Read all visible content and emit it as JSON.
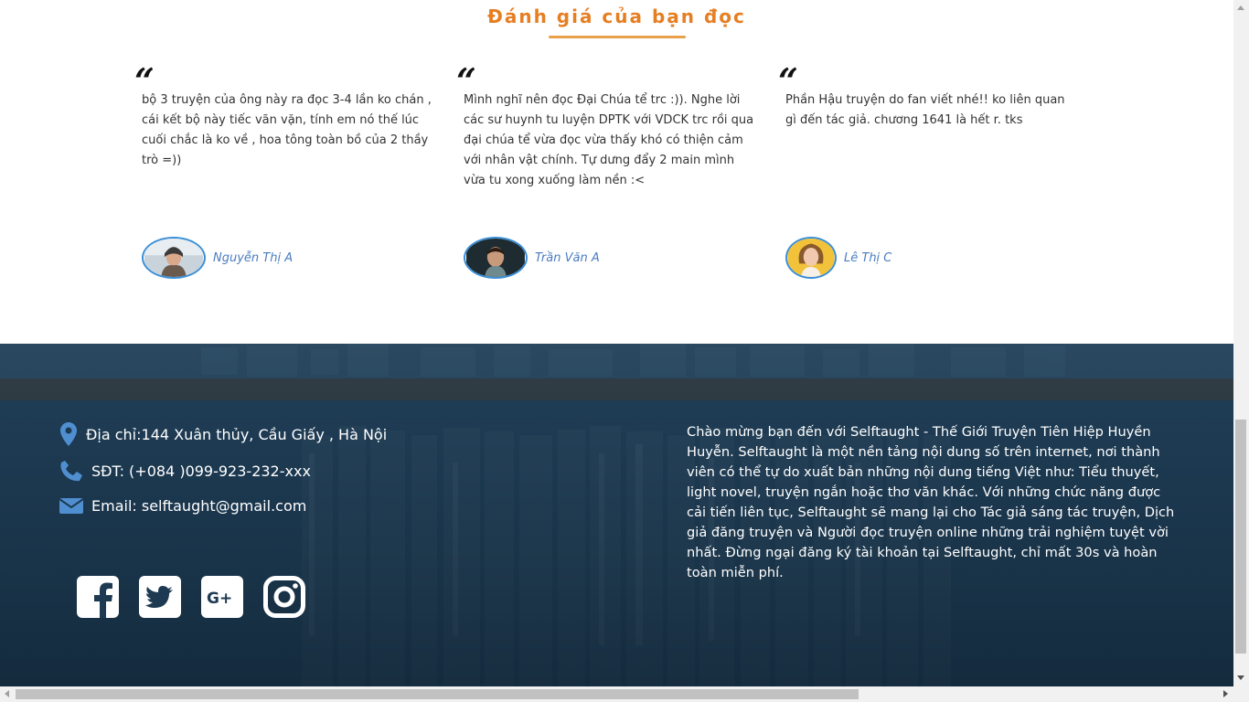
{
  "reviews_section": {
    "title": "Đánh giá của bạn đọc",
    "reviews": [
      {
        "text": "bộ 3 truyện của ông này ra đọc 3-4 lần ko chán , cái kết bộ này tiếc vãn vặn, tính em nó thế lúc cuối chắc là ko về , hoa tông toàn bồ của 2 thầy trò =))",
        "name": "Nguyễn Thị A"
      },
      {
        "text": "Mình nghĩ nên đọc Đại Chúa tể trc :)). Nghe lời các sư huynh tu luyện DPTK với VDCK trc rồi qua đại chúa tể vừa đọc vừa thấy khó có thiện cảm với nhân vật chính. Tự dưng đẩy 2 main mình vừa tu xong xuống làm nền :<",
        "name": "Trần Văn A"
      },
      {
        "text": "Phần Hậu truyện do fan viết nhé!! ko liên quan gì đến tác giả. chương 1641 là hết r. tks",
        "name": "Lê Thị C"
      }
    ]
  },
  "footer": {
    "address": "Địa chỉ:144 Xuân thủy, Cầu Giấy , Hà Nội",
    "phone": "SĐT: (+084 )099-923-232-xxx",
    "email": "Email: selftaught@gmail.com",
    "social": [
      "facebook-icon",
      "twitter-icon",
      "google-plus-icon",
      "instagram-icon"
    ],
    "about": "Chào mừng bạn đến với Selftaught - Thế Giới Truyện Tiên Hiệp Huyền Huyễn. Selftaught là một nền tảng nội dung số trên internet, nơi thành viên có thể tự do xuất bản những nội dung tiếng Việt như: Tiểu thuyết, light novel, truyện ngắn hoặc thơ văn khác. Với những chức năng được cải tiến liên tục, Selftaught sẽ mang lại cho Tác giả sáng tác truyện, Dịch giả đăng truyện và Người đọc truyện online những trải nghiệm tuyệt vời nhất. Đừng ngại đăng ký tài khoản tại Selftaught, chỉ mất 30s và hoàn toàn miễn phí."
  },
  "colors": {
    "accent": "#e67e22",
    "reviewer_name": "#4a7cc0",
    "avatar_border": "#3a8fd8",
    "footer_bg": "#1d3a52"
  }
}
